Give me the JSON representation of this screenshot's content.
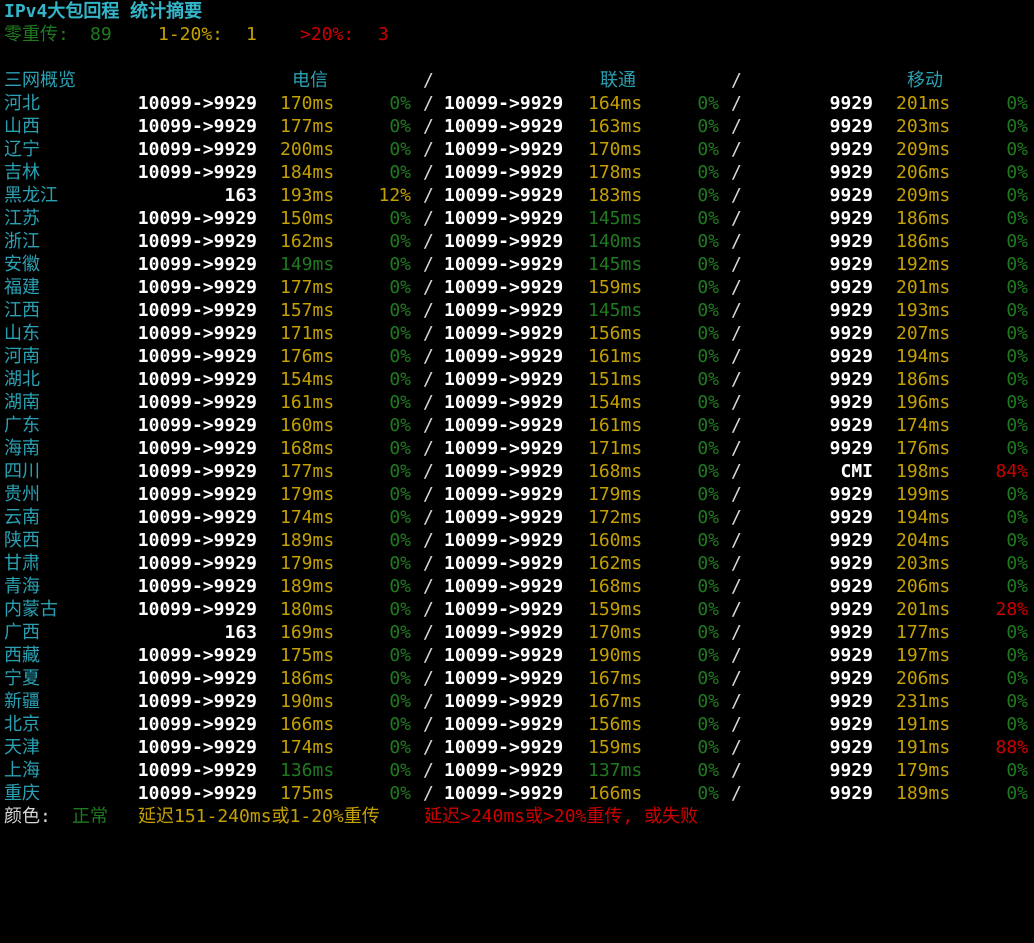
{
  "header": {
    "title": "IPv4大包回程 统计摘要",
    "zero_label": "零重传:",
    "zero_count": "89",
    "mid_label": "1-20%:",
    "mid_count": "1",
    "high_label": ">20%:",
    "high_count": "3"
  },
  "columns": {
    "region": "三网概览",
    "telecom": "电信",
    "unicom": "联通",
    "mobile": "移动",
    "sep": "/"
  },
  "colors": {
    "normal": "#26a269",
    "warn": "#c4a000",
    "bad": "#cc0000"
  },
  "rows": [
    {
      "region": "河北",
      "t_route": "10099->9929",
      "t_lat": "170ms",
      "t_lat_c": "yellow",
      "t_loss": "0%",
      "t_loss_c": "dkgreen",
      "u_route": "10099->9929",
      "u_lat": "164ms",
      "u_lat_c": "yellow",
      "u_loss": "0%",
      "u_loss_c": "dkgreen",
      "m_route": "9929",
      "m_lat": "201ms",
      "m_lat_c": "yellow",
      "m_loss": "0%",
      "m_loss_c": "dkgreen"
    },
    {
      "region": "山西",
      "t_route": "10099->9929",
      "t_lat": "177ms",
      "t_lat_c": "yellow",
      "t_loss": "0%",
      "t_loss_c": "dkgreen",
      "u_route": "10099->9929",
      "u_lat": "163ms",
      "u_lat_c": "yellow",
      "u_loss": "0%",
      "u_loss_c": "dkgreen",
      "m_route": "9929",
      "m_lat": "203ms",
      "m_lat_c": "yellow",
      "m_loss": "0%",
      "m_loss_c": "dkgreen"
    },
    {
      "region": "辽宁",
      "t_route": "10099->9929",
      "t_lat": "200ms",
      "t_lat_c": "yellow",
      "t_loss": "0%",
      "t_loss_c": "dkgreen",
      "u_route": "10099->9929",
      "u_lat": "170ms",
      "u_lat_c": "yellow",
      "u_loss": "0%",
      "u_loss_c": "dkgreen",
      "m_route": "9929",
      "m_lat": "209ms",
      "m_lat_c": "yellow",
      "m_loss": "0%",
      "m_loss_c": "dkgreen"
    },
    {
      "region": "吉林",
      "t_route": "10099->9929",
      "t_lat": "184ms",
      "t_lat_c": "yellow",
      "t_loss": "0%",
      "t_loss_c": "dkgreen",
      "u_route": "10099->9929",
      "u_lat": "178ms",
      "u_lat_c": "yellow",
      "u_loss": "0%",
      "u_loss_c": "dkgreen",
      "m_route": "9929",
      "m_lat": "206ms",
      "m_lat_c": "yellow",
      "m_loss": "0%",
      "m_loss_c": "dkgreen"
    },
    {
      "region": "黑龙江",
      "t_route": "163",
      "t_lat": "193ms",
      "t_lat_c": "yellow",
      "t_loss": "12%",
      "t_loss_c": "yellow",
      "u_route": "10099->9929",
      "u_lat": "183ms",
      "u_lat_c": "yellow",
      "u_loss": "0%",
      "u_loss_c": "dkgreen",
      "m_route": "9929",
      "m_lat": "209ms",
      "m_lat_c": "yellow",
      "m_loss": "0%",
      "m_loss_c": "dkgreen"
    },
    {
      "region": "江苏",
      "t_route": "10099->9929",
      "t_lat": "150ms",
      "t_lat_c": "yellow",
      "t_loss": "0%",
      "t_loss_c": "dkgreen",
      "u_route": "10099->9929",
      "u_lat": "145ms",
      "u_lat_c": "dkgreen",
      "u_loss": "0%",
      "u_loss_c": "dkgreen",
      "m_route": "9929",
      "m_lat": "186ms",
      "m_lat_c": "yellow",
      "m_loss": "0%",
      "m_loss_c": "dkgreen"
    },
    {
      "region": "浙江",
      "t_route": "10099->9929",
      "t_lat": "162ms",
      "t_lat_c": "yellow",
      "t_loss": "0%",
      "t_loss_c": "dkgreen",
      "u_route": "10099->9929",
      "u_lat": "140ms",
      "u_lat_c": "dkgreen",
      "u_loss": "0%",
      "u_loss_c": "dkgreen",
      "m_route": "9929",
      "m_lat": "186ms",
      "m_lat_c": "yellow",
      "m_loss": "0%",
      "m_loss_c": "dkgreen"
    },
    {
      "region": "安徽",
      "t_route": "10099->9929",
      "t_lat": "149ms",
      "t_lat_c": "dkgreen",
      "t_loss": "0%",
      "t_loss_c": "dkgreen",
      "u_route": "10099->9929",
      "u_lat": "145ms",
      "u_lat_c": "dkgreen",
      "u_loss": "0%",
      "u_loss_c": "dkgreen",
      "m_route": "9929",
      "m_lat": "192ms",
      "m_lat_c": "yellow",
      "m_loss": "0%",
      "m_loss_c": "dkgreen"
    },
    {
      "region": "福建",
      "t_route": "10099->9929",
      "t_lat": "177ms",
      "t_lat_c": "yellow",
      "t_loss": "0%",
      "t_loss_c": "dkgreen",
      "u_route": "10099->9929",
      "u_lat": "159ms",
      "u_lat_c": "yellow",
      "u_loss": "0%",
      "u_loss_c": "dkgreen",
      "m_route": "9929",
      "m_lat": "201ms",
      "m_lat_c": "yellow",
      "m_loss": "0%",
      "m_loss_c": "dkgreen"
    },
    {
      "region": "江西",
      "t_route": "10099->9929",
      "t_lat": "157ms",
      "t_lat_c": "yellow",
      "t_loss": "0%",
      "t_loss_c": "dkgreen",
      "u_route": "10099->9929",
      "u_lat": "145ms",
      "u_lat_c": "dkgreen",
      "u_loss": "0%",
      "u_loss_c": "dkgreen",
      "m_route": "9929",
      "m_lat": "193ms",
      "m_lat_c": "yellow",
      "m_loss": "0%",
      "m_loss_c": "dkgreen"
    },
    {
      "region": "山东",
      "t_route": "10099->9929",
      "t_lat": "171ms",
      "t_lat_c": "yellow",
      "t_loss": "0%",
      "t_loss_c": "dkgreen",
      "u_route": "10099->9929",
      "u_lat": "156ms",
      "u_lat_c": "yellow",
      "u_loss": "0%",
      "u_loss_c": "dkgreen",
      "m_route": "9929",
      "m_lat": "207ms",
      "m_lat_c": "yellow",
      "m_loss": "0%",
      "m_loss_c": "dkgreen"
    },
    {
      "region": "河南",
      "t_route": "10099->9929",
      "t_lat": "176ms",
      "t_lat_c": "yellow",
      "t_loss": "0%",
      "t_loss_c": "dkgreen",
      "u_route": "10099->9929",
      "u_lat": "161ms",
      "u_lat_c": "yellow",
      "u_loss": "0%",
      "u_loss_c": "dkgreen",
      "m_route": "9929",
      "m_lat": "194ms",
      "m_lat_c": "yellow",
      "m_loss": "0%",
      "m_loss_c": "dkgreen"
    },
    {
      "region": "湖北",
      "t_route": "10099->9929",
      "t_lat": "154ms",
      "t_lat_c": "yellow",
      "t_loss": "0%",
      "t_loss_c": "dkgreen",
      "u_route": "10099->9929",
      "u_lat": "151ms",
      "u_lat_c": "yellow",
      "u_loss": "0%",
      "u_loss_c": "dkgreen",
      "m_route": "9929",
      "m_lat": "186ms",
      "m_lat_c": "yellow",
      "m_loss": "0%",
      "m_loss_c": "dkgreen"
    },
    {
      "region": "湖南",
      "t_route": "10099->9929",
      "t_lat": "161ms",
      "t_lat_c": "yellow",
      "t_loss": "0%",
      "t_loss_c": "dkgreen",
      "u_route": "10099->9929",
      "u_lat": "154ms",
      "u_lat_c": "yellow",
      "u_loss": "0%",
      "u_loss_c": "dkgreen",
      "m_route": "9929",
      "m_lat": "196ms",
      "m_lat_c": "yellow",
      "m_loss": "0%",
      "m_loss_c": "dkgreen"
    },
    {
      "region": "广东",
      "t_route": "10099->9929",
      "t_lat": "160ms",
      "t_lat_c": "yellow",
      "t_loss": "0%",
      "t_loss_c": "dkgreen",
      "u_route": "10099->9929",
      "u_lat": "161ms",
      "u_lat_c": "yellow",
      "u_loss": "0%",
      "u_loss_c": "dkgreen",
      "m_route": "9929",
      "m_lat": "174ms",
      "m_lat_c": "yellow",
      "m_loss": "0%",
      "m_loss_c": "dkgreen"
    },
    {
      "region": "海南",
      "t_route": "10099->9929",
      "t_lat": "168ms",
      "t_lat_c": "yellow",
      "t_loss": "0%",
      "t_loss_c": "dkgreen",
      "u_route": "10099->9929",
      "u_lat": "171ms",
      "u_lat_c": "yellow",
      "u_loss": "0%",
      "u_loss_c": "dkgreen",
      "m_route": "9929",
      "m_lat": "176ms",
      "m_lat_c": "yellow",
      "m_loss": "0%",
      "m_loss_c": "dkgreen"
    },
    {
      "region": "四川",
      "t_route": "10099->9929",
      "t_lat": "177ms",
      "t_lat_c": "yellow",
      "t_loss": "0%",
      "t_loss_c": "dkgreen",
      "u_route": "10099->9929",
      "u_lat": "168ms",
      "u_lat_c": "yellow",
      "u_loss": "0%",
      "u_loss_c": "dkgreen",
      "m_route": "CMI",
      "m_lat": "198ms",
      "m_lat_c": "yellow",
      "m_loss": "84%",
      "m_loss_c": "red"
    },
    {
      "region": "贵州",
      "t_route": "10099->9929",
      "t_lat": "179ms",
      "t_lat_c": "yellow",
      "t_loss": "0%",
      "t_loss_c": "dkgreen",
      "u_route": "10099->9929",
      "u_lat": "179ms",
      "u_lat_c": "yellow",
      "u_loss": "0%",
      "u_loss_c": "dkgreen",
      "m_route": "9929",
      "m_lat": "199ms",
      "m_lat_c": "yellow",
      "m_loss": "0%",
      "m_loss_c": "dkgreen"
    },
    {
      "region": "云南",
      "t_route": "10099->9929",
      "t_lat": "174ms",
      "t_lat_c": "yellow",
      "t_loss": "0%",
      "t_loss_c": "dkgreen",
      "u_route": "10099->9929",
      "u_lat": "172ms",
      "u_lat_c": "yellow",
      "u_loss": "0%",
      "u_loss_c": "dkgreen",
      "m_route": "9929",
      "m_lat": "194ms",
      "m_lat_c": "yellow",
      "m_loss": "0%",
      "m_loss_c": "dkgreen"
    },
    {
      "region": "陕西",
      "t_route": "10099->9929",
      "t_lat": "189ms",
      "t_lat_c": "yellow",
      "t_loss": "0%",
      "t_loss_c": "dkgreen",
      "u_route": "10099->9929",
      "u_lat": "160ms",
      "u_lat_c": "yellow",
      "u_loss": "0%",
      "u_loss_c": "dkgreen",
      "m_route": "9929",
      "m_lat": "204ms",
      "m_lat_c": "yellow",
      "m_loss": "0%",
      "m_loss_c": "dkgreen"
    },
    {
      "region": "甘肃",
      "t_route": "10099->9929",
      "t_lat": "179ms",
      "t_lat_c": "yellow",
      "t_loss": "0%",
      "t_loss_c": "dkgreen",
      "u_route": "10099->9929",
      "u_lat": "162ms",
      "u_lat_c": "yellow",
      "u_loss": "0%",
      "u_loss_c": "dkgreen",
      "m_route": "9929",
      "m_lat": "203ms",
      "m_lat_c": "yellow",
      "m_loss": "0%",
      "m_loss_c": "dkgreen"
    },
    {
      "region": "青海",
      "t_route": "10099->9929",
      "t_lat": "189ms",
      "t_lat_c": "yellow",
      "t_loss": "0%",
      "t_loss_c": "dkgreen",
      "u_route": "10099->9929",
      "u_lat": "168ms",
      "u_lat_c": "yellow",
      "u_loss": "0%",
      "u_loss_c": "dkgreen",
      "m_route": "9929",
      "m_lat": "206ms",
      "m_lat_c": "yellow",
      "m_loss": "0%",
      "m_loss_c": "dkgreen"
    },
    {
      "region": "内蒙古",
      "t_route": "10099->9929",
      "t_lat": "180ms",
      "t_lat_c": "yellow",
      "t_loss": "0%",
      "t_loss_c": "dkgreen",
      "u_route": "10099->9929",
      "u_lat": "159ms",
      "u_lat_c": "yellow",
      "u_loss": "0%",
      "u_loss_c": "dkgreen",
      "m_route": "9929",
      "m_lat": "201ms",
      "m_lat_c": "yellow",
      "m_loss": "28%",
      "m_loss_c": "red"
    },
    {
      "region": "广西",
      "t_route": "163",
      "t_lat": "169ms",
      "t_lat_c": "yellow",
      "t_loss": "0%",
      "t_loss_c": "dkgreen",
      "u_route": "10099->9929",
      "u_lat": "170ms",
      "u_lat_c": "yellow",
      "u_loss": "0%",
      "u_loss_c": "dkgreen",
      "m_route": "9929",
      "m_lat": "177ms",
      "m_lat_c": "yellow",
      "m_loss": "0%",
      "m_loss_c": "dkgreen"
    },
    {
      "region": "西藏",
      "t_route": "10099->9929",
      "t_lat": "175ms",
      "t_lat_c": "yellow",
      "t_loss": "0%",
      "t_loss_c": "dkgreen",
      "u_route": "10099->9929",
      "u_lat": "190ms",
      "u_lat_c": "yellow",
      "u_loss": "0%",
      "u_loss_c": "dkgreen",
      "m_route": "9929",
      "m_lat": "197ms",
      "m_lat_c": "yellow",
      "m_loss": "0%",
      "m_loss_c": "dkgreen"
    },
    {
      "region": "宁夏",
      "t_route": "10099->9929",
      "t_lat": "186ms",
      "t_lat_c": "yellow",
      "t_loss": "0%",
      "t_loss_c": "dkgreen",
      "u_route": "10099->9929",
      "u_lat": "167ms",
      "u_lat_c": "yellow",
      "u_loss": "0%",
      "u_loss_c": "dkgreen",
      "m_route": "9929",
      "m_lat": "206ms",
      "m_lat_c": "yellow",
      "m_loss": "0%",
      "m_loss_c": "dkgreen"
    },
    {
      "region": "新疆",
      "t_route": "10099->9929",
      "t_lat": "190ms",
      "t_lat_c": "yellow",
      "t_loss": "0%",
      "t_loss_c": "dkgreen",
      "u_route": "10099->9929",
      "u_lat": "167ms",
      "u_lat_c": "yellow",
      "u_loss": "0%",
      "u_loss_c": "dkgreen",
      "m_route": "9929",
      "m_lat": "231ms",
      "m_lat_c": "yellow",
      "m_loss": "0%",
      "m_loss_c": "dkgreen"
    },
    {
      "region": "北京",
      "t_route": "10099->9929",
      "t_lat": "166ms",
      "t_lat_c": "yellow",
      "t_loss": "0%",
      "t_loss_c": "dkgreen",
      "u_route": "10099->9929",
      "u_lat": "156ms",
      "u_lat_c": "yellow",
      "u_loss": "0%",
      "u_loss_c": "dkgreen",
      "m_route": "9929",
      "m_lat": "191ms",
      "m_lat_c": "yellow",
      "m_loss": "0%",
      "m_loss_c": "dkgreen"
    },
    {
      "region": "天津",
      "t_route": "10099->9929",
      "t_lat": "174ms",
      "t_lat_c": "yellow",
      "t_loss": "0%",
      "t_loss_c": "dkgreen",
      "u_route": "10099->9929",
      "u_lat": "159ms",
      "u_lat_c": "yellow",
      "u_loss": "0%",
      "u_loss_c": "dkgreen",
      "m_route": "9929",
      "m_lat": "191ms",
      "m_lat_c": "yellow",
      "m_loss": "88%",
      "m_loss_c": "red"
    },
    {
      "region": "上海",
      "t_route": "10099->9929",
      "t_lat": "136ms",
      "t_lat_c": "dkgreen",
      "t_loss": "0%",
      "t_loss_c": "dkgreen",
      "u_route": "10099->9929",
      "u_lat": "137ms",
      "u_lat_c": "dkgreen",
      "u_loss": "0%",
      "u_loss_c": "dkgreen",
      "m_route": "9929",
      "m_lat": "179ms",
      "m_lat_c": "yellow",
      "m_loss": "0%",
      "m_loss_c": "dkgreen"
    },
    {
      "region": "重庆",
      "t_route": "10099->9929",
      "t_lat": "175ms",
      "t_lat_c": "yellow",
      "t_loss": "0%",
      "t_loss_c": "dkgreen",
      "u_route": "10099->9929",
      "u_lat": "166ms",
      "u_lat_c": "yellow",
      "u_loss": "0%",
      "u_loss_c": "dkgreen",
      "m_route": "9929",
      "m_lat": "189ms",
      "m_lat_c": "yellow",
      "m_loss": "0%",
      "m_loss_c": "dkgreen"
    }
  ],
  "legend": {
    "label": "颜色:",
    "normal": "正常",
    "warn": "延迟151-240ms或1-20%重传",
    "bad": "延迟>240ms或>20%重传, 或失败"
  }
}
